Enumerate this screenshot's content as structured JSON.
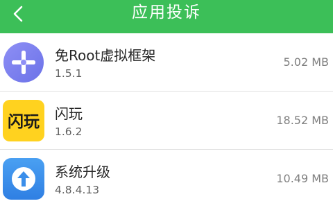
{
  "header": {
    "title": "应用投诉",
    "back_icon": "chevron-left-icon",
    "background": "#3cbf58"
  },
  "apps": [
    {
      "name": "免Root虚拟框架",
      "version": "1.5.1",
      "size": "5.02 MB",
      "icon": "plus-cross-app-icon",
      "icon_color": "#7b7ff0"
    },
    {
      "name": "闪玩",
      "version": "1.6.2",
      "size": "18.52 MB",
      "icon": "shanwan-logo-icon",
      "icon_color": "#ffd21f",
      "icon_text": "闪玩"
    },
    {
      "name": "系统升级",
      "version": "4.8.4.13",
      "size": "10.49 MB",
      "icon": "upgrade-arrow-icon",
      "icon_color": "#3a8eea"
    }
  ]
}
